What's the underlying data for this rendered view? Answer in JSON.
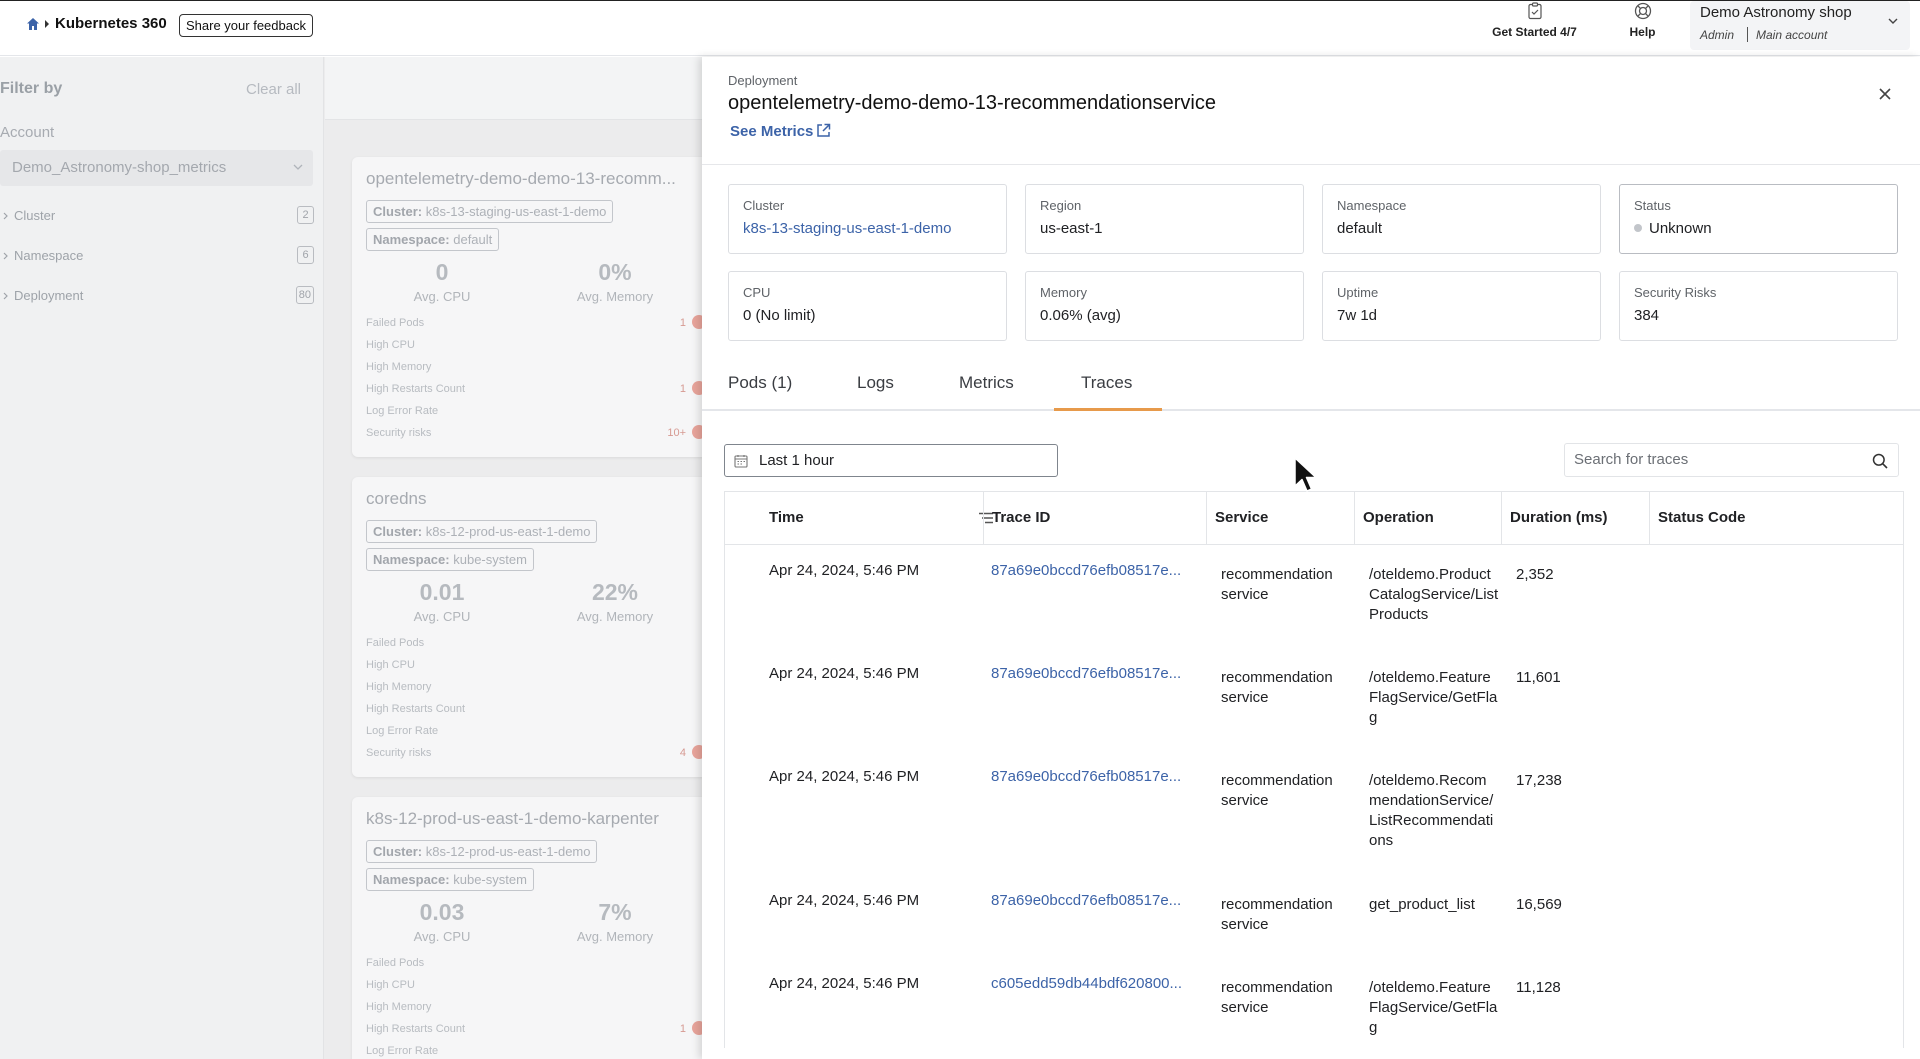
{
  "header": {
    "brand": "Kubernetes 360",
    "feedback_label": "Share your feedback",
    "get_started": "Get Started 4/7",
    "help": "Help",
    "account_name": "Demo Astronomy shop",
    "account_role": "Admin",
    "account_sub": "Main account"
  },
  "filter": {
    "title": "Filter by",
    "clear": "Clear all",
    "account_label": "Account",
    "account_value": "Demo_Astronomy-shop_metrics",
    "groups": [
      {
        "label": "Cluster",
        "count": "2"
      },
      {
        "label": "Namespace",
        "count": "6"
      },
      {
        "label": "Deployment",
        "count": "80"
      }
    ]
  },
  "cards": [
    {
      "title": "opentelemetry-demo-demo-13-recomm...",
      "cluster": "k8s-13-staging-us-east-1-demo",
      "namespace": "default",
      "cpu": "0",
      "cpu_label": "Avg. CPU",
      "memory": "0%",
      "memory_label": "Avg. Memory",
      "metrics": [
        {
          "label": "Failed Pods",
          "value": "1"
        },
        {
          "label": "High CPU",
          "value": ""
        },
        {
          "label": "High Memory",
          "value": ""
        },
        {
          "label": "High Restarts Count",
          "value": "1"
        },
        {
          "label": "Log Error Rate",
          "value": ""
        },
        {
          "label": "Security risks",
          "value": "10+"
        }
      ]
    },
    {
      "title": "coredns",
      "cluster": "k8s-12-prod-us-east-1-demo",
      "namespace": "kube-system",
      "cpu": "0.01",
      "cpu_label": "Avg. CPU",
      "memory": "22%",
      "memory_label": "Avg. Memory",
      "metrics": [
        {
          "label": "Failed Pods",
          "value": ""
        },
        {
          "label": "High CPU",
          "value": ""
        },
        {
          "label": "High Memory",
          "value": ""
        },
        {
          "label": "High Restarts Count",
          "value": ""
        },
        {
          "label": "Log Error Rate",
          "value": ""
        },
        {
          "label": "Security risks",
          "value": "4"
        }
      ]
    },
    {
      "title": "k8s-12-prod-us-east-1-demo-karpenter",
      "cluster": "k8s-12-prod-us-east-1-demo",
      "namespace": "kube-system",
      "cpu": "0.03",
      "cpu_label": "Avg. CPU",
      "memory": "7%",
      "memory_label": "Avg. Memory",
      "metrics": [
        {
          "label": "Failed Pods",
          "value": ""
        },
        {
          "label": "High CPU",
          "value": ""
        },
        {
          "label": "High Memory",
          "value": ""
        },
        {
          "label": "High Restarts Count",
          "value": "1"
        },
        {
          "label": "Log Error Rate",
          "value": ""
        }
      ]
    }
  ],
  "card_tag_labels": {
    "cluster": "Cluster:",
    "namespace": "Namespace:"
  },
  "drawer": {
    "kind": "Deployment",
    "title": "opentelemetry-demo-demo-13-recommendationservice",
    "see_metrics": "See Metrics",
    "info": [
      {
        "label": "Cluster",
        "value": "k8s-13-staging-us-east-1-demo",
        "link": true
      },
      {
        "label": "Region",
        "value": "us-east-1"
      },
      {
        "label": "Namespace",
        "value": "default"
      },
      {
        "label": "Status",
        "value": "Unknown",
        "status": true
      },
      {
        "label": "CPU",
        "value": "0 (No limit)"
      },
      {
        "label": "Memory",
        "value": "0.06% (avg)"
      },
      {
        "label": "Uptime",
        "value": "7w 1d"
      },
      {
        "label": "Security Risks",
        "value": "384"
      }
    ],
    "tabs": [
      "Pods (1)",
      "Logs",
      "Metrics",
      "Traces"
    ],
    "active_tab": "Traces",
    "time_range": "Last 1 hour",
    "search_placeholder": "Search for traces",
    "columns": [
      "Time",
      "Trace ID",
      "Service",
      "Operation",
      "Duration (ms)",
      "Status Code"
    ],
    "rows": [
      {
        "time": "Apr 24, 2024, 5:46 PM",
        "trace_id": "87a69e0bccd76efb08517e...",
        "service": "recommendation service",
        "operation": "/oteldemo.ProductCatalogService/ListProducts",
        "duration": "2,352",
        "status": ""
      },
      {
        "time": "Apr 24, 2024, 5:46 PM",
        "trace_id": "87a69e0bccd76efb08517e...",
        "service": "recommendation service",
        "operation": "/oteldemo.FeatureFlagService/GetFlag",
        "duration": "11,601",
        "status": ""
      },
      {
        "time": "Apr 24, 2024, 5:46 PM",
        "trace_id": "87a69e0bccd76efb08517e...",
        "service": "recommendation service",
        "operation": "/oteldemo.RecommendationService/ListRecommendations",
        "duration": "17,238",
        "status": ""
      },
      {
        "time": "Apr 24, 2024, 5:46 PM",
        "trace_id": "87a69e0bccd76efb08517e...",
        "service": "recommendation service",
        "operation": "get_product_list",
        "duration": "16,569",
        "status": ""
      },
      {
        "time": "Apr 24, 2024, 5:46 PM",
        "trace_id": "c605edd59db44bdf620800...",
        "service": "recommendation service",
        "operation": "/oteldemo.FeatureFlagService/GetFlag",
        "duration": "11,128",
        "status": ""
      }
    ]
  },
  "colors": {
    "accent_tab": "#e79a4b",
    "link": "#3c63a8",
    "risk_dot": "#e8a49b"
  },
  "icons": [
    "home-icon",
    "clipboard-icon",
    "help-icon",
    "chevron-down-icon",
    "external-link-icon",
    "close-icon",
    "calendar-icon",
    "search-icon",
    "sort-icon",
    "mouse-cursor-icon"
  ]
}
